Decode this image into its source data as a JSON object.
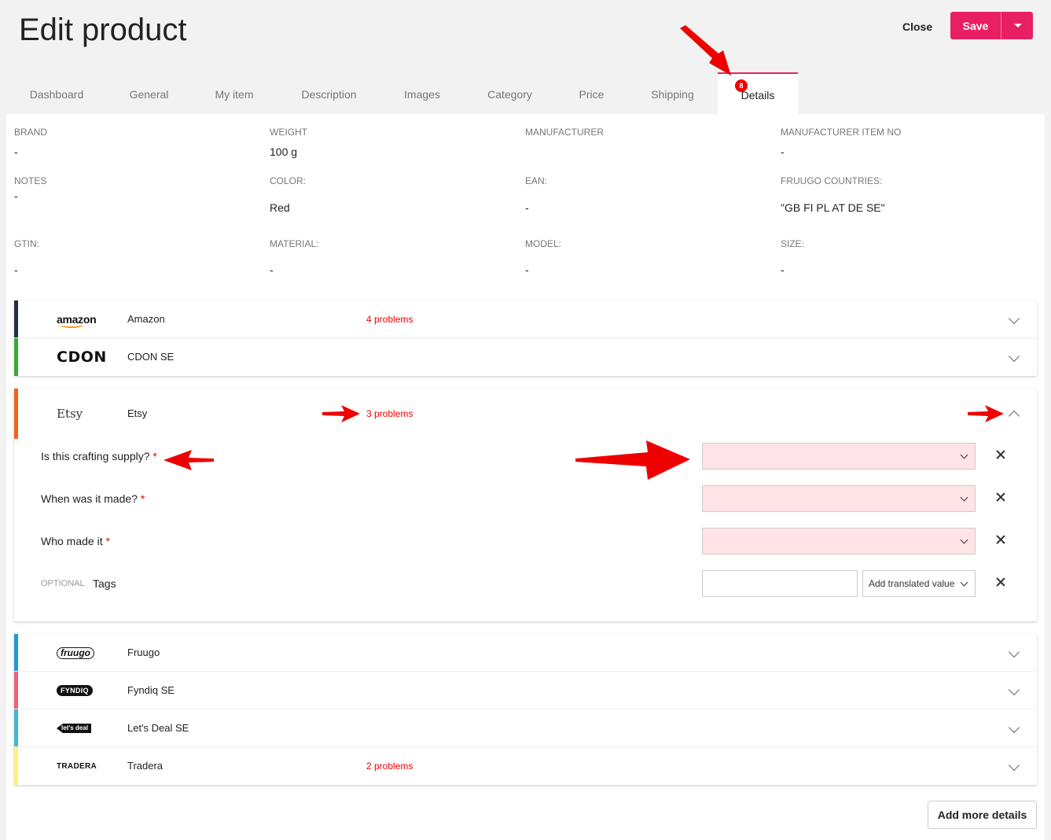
{
  "header": {
    "title": "Edit product",
    "close_label": "Close",
    "save_label": "Save"
  },
  "tabs": [
    {
      "label": "Dashboard"
    },
    {
      "label": "General"
    },
    {
      "label": "My item"
    },
    {
      "label": "Description"
    },
    {
      "label": "Images"
    },
    {
      "label": "Category"
    },
    {
      "label": "Price"
    },
    {
      "label": "Shipping"
    },
    {
      "label": "Details",
      "badge": "8",
      "active": true
    }
  ],
  "attributes": [
    {
      "label": "BRAND",
      "value": "-"
    },
    {
      "label": "WEIGHT",
      "value": "100 g"
    },
    {
      "label": "MANUFACTURER",
      "value": ""
    },
    {
      "label": "MANUFACTURER ITEM NO",
      "value": "-"
    },
    {
      "label": "NOTES",
      "value": "-"
    },
    {
      "label": "COLOR:",
      "value": "Red"
    },
    {
      "label": "EAN:",
      "value": "-"
    },
    {
      "label": "FRUUGO COUNTRIES:",
      "value": "\"GB FI PL AT DE SE\""
    },
    {
      "label": "GTIN:",
      "value": "-"
    },
    {
      "label": "MATERIAL:",
      "value": "-"
    },
    {
      "label": "MODEL:",
      "value": "-"
    },
    {
      "label": "SIZE:",
      "value": "-"
    }
  ],
  "marketplaces_top": [
    {
      "logo": "amazon",
      "name": "Amazon",
      "problems": "4 problems",
      "color": "#232f3e"
    },
    {
      "logo": "CDON",
      "name": "CDON SE",
      "problems": "",
      "color": "#3aaa35"
    }
  ],
  "etsy": {
    "logo": "Etsy",
    "name": "Etsy",
    "problems": "3 problems",
    "color": "#f1641e",
    "fields": [
      {
        "label": "Is this crafting supply?",
        "required": "*"
      },
      {
        "label": "When was it made?",
        "required": "*"
      },
      {
        "label": "Who made it",
        "required": "*"
      }
    ],
    "optional_label": "OPTIONAL",
    "tags_label": "Tags",
    "translated_placeholder": "Add translated value"
  },
  "marketplaces_bottom": [
    {
      "logo": "fruugo",
      "name": "Fruugo",
      "problems": "",
      "color": "#1e9ad6"
    },
    {
      "logo": "FYNDIQ",
      "name": "Fyndiq SE",
      "problems": "",
      "color": "#f0607a"
    },
    {
      "logo": "let's deal",
      "name": "Let's Deal SE",
      "problems": "",
      "color": "#44b6cf"
    },
    {
      "logo": "TRADERA",
      "name": "Tradera",
      "problems": "2 problems",
      "color": "#ffef7a"
    }
  ],
  "add_more_label": "Add more details",
  "colors": {
    "accent": "#e81f63",
    "error": "#e00000",
    "invalid_field": "#ffe3e7"
  }
}
